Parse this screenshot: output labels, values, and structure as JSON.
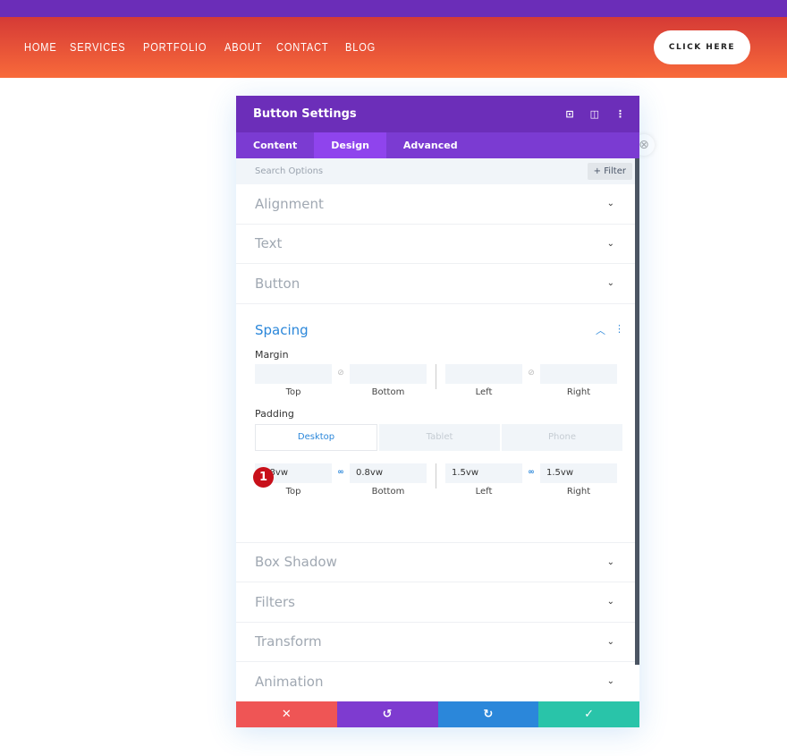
{
  "nav": {
    "items": [
      "HOME",
      "SERVICES",
      "PORTFOLIO",
      "ABOUT",
      "CONTACT",
      "BLOG"
    ],
    "cta": "CLICK HERE"
  },
  "panel": {
    "title": "Button Settings",
    "tabs": [
      "Content",
      "Design",
      "Advanced"
    ],
    "active_tab": "Design",
    "search_placeholder": "Search Options",
    "filter": "+ Filter",
    "sections_top": [
      "Alignment",
      "Text",
      "Button"
    ],
    "spacing": {
      "title": "Spacing",
      "margin_label": "Margin",
      "padding_label": "Padding",
      "captions": [
        "Top",
        "Bottom",
        "Left",
        "Right"
      ],
      "margin_values": [
        "",
        "",
        "",
        ""
      ],
      "devices": [
        "Desktop",
        "Tablet",
        "Phone"
      ],
      "padding_values": [
        "0.8vw",
        "0.8vw",
        "1.5vw",
        "1.5vw"
      ],
      "badge": "1"
    },
    "sections_bottom": [
      "Box Shadow",
      "Filters",
      "Transform",
      "Animation"
    ]
  },
  "colors": {
    "purple": "#6c2eb9",
    "cancel": "#ef5555",
    "undo": "#7e3bd0",
    "redo": "#2b87da",
    "save": "#29c4a9"
  }
}
